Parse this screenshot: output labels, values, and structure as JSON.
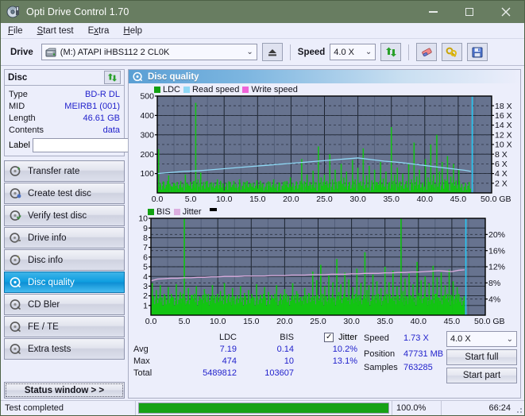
{
  "window": {
    "title": "Opti Drive Control 1.70",
    "icon": "disc-drive-icon",
    "minimize": "–",
    "maximize": "□",
    "close": "✕"
  },
  "menu": [
    {
      "label": "File",
      "accel": "F"
    },
    {
      "label": "Start test",
      "accel": "S"
    },
    {
      "label": "Extra",
      "accel": "x"
    },
    {
      "label": "Help",
      "accel": "H"
    }
  ],
  "toolbar": {
    "drive_label": "Drive",
    "drive_value": "(M:) ATAPI iHBS112  2 CL0K",
    "eject_icon": "eject-icon",
    "speed_label": "Speed",
    "speed_value": "4.0 X",
    "refresh_icon": "refresh-icon",
    "erase_icon": "eraser-icon",
    "settings_icon": "options-icon",
    "save_icon": "save-icon"
  },
  "disc": {
    "group_title": "Disc",
    "refresh_icon": "refresh-icon",
    "rows": [
      {
        "key": "Type",
        "value": "BD-R DL"
      },
      {
        "key": "MID",
        "value": "MEIRB1 (001)"
      },
      {
        "key": "Length",
        "value": "46.61 GB"
      },
      {
        "key": "Contents",
        "value": "data"
      }
    ],
    "label_key": "Label",
    "label_value": "",
    "label_placeholder": "",
    "label_button_icon": "disc-icon"
  },
  "sidebar": {
    "items": [
      {
        "label": "Transfer rate",
        "icon": "disc-speed-icon",
        "active": false
      },
      {
        "label": "Create test disc",
        "icon": "disc-burn-icon",
        "active": false
      },
      {
        "label": "Verify test disc",
        "icon": "disc-verify-icon",
        "active": false
      },
      {
        "label": "Drive info",
        "icon": "drive-info-icon",
        "active": false
      },
      {
        "label": "Disc info",
        "icon": "disc-info-icon",
        "active": false
      },
      {
        "label": "Disc quality",
        "icon": "disc-quality-icon",
        "active": true
      },
      {
        "label": "CD Bler",
        "icon": "disc-bler-icon",
        "active": false
      },
      {
        "label": "FE / TE",
        "icon": "disc-fete-icon",
        "active": false
      },
      {
        "label": "Extra tests",
        "icon": "disc-extra-icon",
        "active": false
      }
    ],
    "status_window": "Status window > >"
  },
  "panel": {
    "title": "Disc quality",
    "icon": "disc-quality-icon"
  },
  "stats": {
    "headers": {
      "blank": "",
      "ldc": "LDC",
      "bis": "BIS",
      "jitter": "Jitter"
    },
    "jitter_checked": true,
    "jitter_check_glyph": "✓",
    "rows": [
      {
        "label": "Avg",
        "ldc": "7.19",
        "bis": "0.14",
        "jitter": "10.2%"
      },
      {
        "label": "Max",
        "ldc": "474",
        "bis": "10",
        "jitter": "13.1%"
      },
      {
        "label": "Total",
        "ldc": "5489812",
        "bis": "103607",
        "jitter": ""
      }
    ]
  },
  "readout": {
    "speed_label": "Speed",
    "speed_value": "1.73 X",
    "position_label": "Position",
    "position_value": "47731 MB",
    "samples_label": "Samples",
    "samples_value": "763285",
    "speed_select": "4.0 X",
    "start_full": "Start full",
    "start_part": "Start part"
  },
  "statusbar": {
    "message": "Test completed",
    "percent_text": "100.0%",
    "percent_value": 100,
    "elapsed": "66:24"
  },
  "colors": {
    "title_bar": "#687d61",
    "ldc": "#12c412",
    "bis": "#12c412",
    "read_speed": "#8fd8f5",
    "write_speed": "#ef63d8",
    "jitter": "#dcaee0",
    "plot_bg": "#67738f",
    "accent": "#2222cc",
    "progress": "#16a216"
  },
  "chart_data": [
    {
      "type": "line",
      "title": "Disc quality - LDC / Read speed",
      "xlabel": "GB",
      "ylabel": "LDC",
      "xlim": [
        0,
        50
      ],
      "ylim": [
        0,
        500
      ],
      "xticks": [
        "0.0",
        "5.0",
        "10.0",
        "15.0",
        "20.0",
        "25.0",
        "30.0",
        "35.0",
        "40.0",
        "45.0",
        "50.0 GB"
      ],
      "yticks_left": [
        "100",
        "200",
        "300",
        "400",
        "500"
      ],
      "yticks_right": [
        "2 X",
        "4 X",
        "6 X",
        "8 X",
        "10 X",
        "12 X",
        "14 X",
        "16 X",
        "18 X"
      ],
      "ylim_right": [
        0,
        18
      ],
      "grid": true,
      "legend": [
        {
          "label": "LDC",
          "color": "#12a012"
        },
        {
          "label": "Read speed",
          "color": "#8fd8f5"
        },
        {
          "label": "Write speed",
          "color": "#ef63d8"
        }
      ],
      "series": [
        {
          "name": "LDC",
          "kind": "bars",
          "color": "#12c412",
          "x": [
            0.2,
            0.5,
            0.9,
            1.3,
            1.7,
            2.1,
            2.6,
            3.0,
            3.4,
            3.8,
            4.2,
            4.6,
            5.0,
            5.4,
            5.75,
            6.1,
            6.5,
            6.9,
            7.3,
            7.7,
            8.1,
            8.6,
            9.0,
            9.4,
            9.8,
            10.2,
            10.7,
            11.1,
            11.5,
            11.9,
            12.3,
            12.8,
            13.2,
            13.6,
            14.0,
            14.5,
            14.9,
            15.3,
            15.7,
            16.1,
            16.6,
            17.0,
            17.4,
            17.8,
            18.2,
            18.7,
            19.1,
            19.5,
            19.9,
            20.3,
            20.8,
            21.2,
            21.6,
            22.0,
            22.4,
            22.9,
            23.3,
            23.7,
            24.1,
            24.5,
            25.0,
            25.4,
            25.8,
            26.2,
            26.6,
            27.1,
            27.5,
            27.9,
            28.3,
            28.7,
            29.2,
            29.6,
            30.0,
            30.4,
            30.8,
            31.3,
            31.7,
            32.1,
            32.5,
            32.9,
            33.4,
            33.8,
            34.2,
            34.6,
            35.0,
            35.5,
            35.9,
            36.3,
            36.7,
            37.1,
            37.6,
            38.0,
            38.4,
            38.8,
            39.2,
            39.7,
            40.1,
            40.5,
            40.9,
            41.3,
            41.8,
            42.2,
            42.6,
            43.0,
            43.4,
            43.9,
            44.3,
            44.7,
            45.1,
            45.5,
            46.0,
            46.4,
            46.8
          ],
          "y": [
            225,
            40,
            60,
            30,
            90,
            35,
            50,
            25,
            40,
            30,
            95,
            45,
            35,
            60,
            465,
            70,
            105,
            40,
            60,
            30,
            55,
            25,
            70,
            35,
            50,
            20,
            60,
            30,
            45,
            25,
            70,
            35,
            55,
            30,
            50,
            25,
            65,
            30,
            50,
            25,
            60,
            30,
            70,
            35,
            55,
            25,
            60,
            30,
            80,
            40,
            60,
            30,
            175,
            60,
            95,
            45,
            115,
            55,
            240,
            80,
            95,
            50,
            200,
            70,
            120,
            60,
            150,
            80,
            110,
            55,
            170,
            70,
            130,
            60,
            230,
            90,
            140,
            65,
            120,
            55,
            160,
            75,
            110,
            50,
            340,
            95,
            130,
            60,
            100,
            45,
            150,
            70,
            260,
            85,
            120,
            55,
            175,
            80,
            250,
            95,
            300,
            110,
            160,
            70,
            190,
            85,
            150,
            65,
            120
          ]
        },
        {
          "name": "Read speed",
          "kind": "line",
          "color": "#8fd8f5",
          "axis": "right",
          "x": [
            0,
            2,
            4,
            6,
            8,
            10,
            12,
            14,
            16,
            18,
            20,
            22,
            24,
            26,
            28,
            30,
            32,
            34,
            36,
            38,
            40,
            42,
            44,
            46,
            46.9
          ],
          "y": [
            3.6,
            3.8,
            4.0,
            4.1,
            4.3,
            4.5,
            4.7,
            4.9,
            5.1,
            5.3,
            5.5,
            5.7,
            5.9,
            6.1,
            6.3,
            6.5,
            6.2,
            5.9,
            5.7,
            5.4,
            5.1,
            4.8,
            4.5,
            4.2,
            4.0
          ]
        },
        {
          "name": "Write speed",
          "kind": "line",
          "color": "#ef63d8",
          "axis": "right",
          "x": [],
          "y": []
        },
        {
          "name": "Marker",
          "kind": "vline",
          "color": "#28c8f4",
          "x": [
            47.1
          ],
          "y": []
        }
      ]
    },
    {
      "type": "line",
      "title": "Disc quality - BIS / Jitter",
      "xlabel": "GB",
      "ylabel": "BIS",
      "xlim": [
        0,
        50
      ],
      "ylim": [
        0,
        10
      ],
      "xticks": [
        "0.0",
        "5.0",
        "10.0",
        "15.0",
        "20.0",
        "25.0",
        "30.0",
        "35.0",
        "40.0",
        "45.0",
        "50.0 GB"
      ],
      "yticks_left": [
        "1",
        "2",
        "3",
        "4",
        "5",
        "6",
        "7",
        "8",
        "9",
        "10"
      ],
      "yticks_right": [
        "4%",
        "8%",
        "12%",
        "16%",
        "20%"
      ],
      "ylim_right": [
        0,
        22
      ],
      "grid": true,
      "legend": [
        {
          "label": "BIS",
          "color": "#12a012"
        },
        {
          "label": "Jitter",
          "color": "#dcaee0"
        }
      ],
      "series": [
        {
          "name": "BIS",
          "kind": "bars",
          "color": "#12c412",
          "x": [
            0.2,
            0.5,
            0.8,
            1.1,
            1.4,
            1.7,
            2.0,
            2.3,
            2.6,
            2.9,
            3.2,
            3.5,
            3.8,
            4.1,
            4.4,
            4.7,
            5.0,
            5.3,
            5.6,
            5.9,
            6.2,
            6.5,
            6.8,
            7.1,
            7.4,
            7.7,
            8.0,
            8.3,
            8.6,
            8.9,
            9.2,
            9.5,
            9.8,
            10.1,
            10.4,
            10.7,
            11.0,
            11.3,
            11.6,
            11.9,
            12.2,
            12.5,
            12.8,
            13.1,
            13.4,
            13.7,
            14.0,
            14.3,
            14.6,
            14.9,
            15.2,
            15.5,
            15.8,
            16.1,
            16.4,
            16.7,
            17.0,
            17.3,
            17.6,
            17.9,
            18.2,
            18.5,
            18.8,
            19.1,
            19.4,
            19.7,
            20.0,
            20.3,
            20.6,
            20.9,
            21.2,
            21.5,
            21.8,
            22.1,
            22.4,
            22.7,
            23.0,
            23.3,
            23.6,
            23.9,
            24.2,
            24.5,
            24.8,
            25.1,
            25.4,
            25.7,
            26.0,
            26.3,
            26.6,
            26.9,
            27.2,
            27.5,
            27.8,
            28.1,
            28.4,
            28.7,
            29.0,
            29.3,
            29.6,
            29.9,
            30.2,
            30.5,
            30.8,
            31.1,
            31.4,
            31.7,
            32.0,
            32.3,
            32.6,
            32.9,
            33.2,
            33.5,
            33.8,
            34.1,
            34.4,
            34.7,
            35.0,
            35.3,
            35.6,
            35.9,
            36.2,
            36.5,
            36.8,
            37.1,
            37.4,
            37.7,
            38.0,
            38.3,
            38.6,
            38.9,
            39.2,
            39.5,
            39.8,
            40.1,
            40.4,
            40.7,
            41.0,
            41.3,
            41.6,
            41.9,
            42.2,
            42.5,
            42.8,
            43.1,
            43.4,
            43.7,
            44.0,
            44.3,
            44.6,
            44.9,
            45.2,
            45.5,
            45.8,
            46.1,
            46.4,
            46.7
          ],
          "y": [
            3.3,
            1.1,
            2.6,
            1.0,
            3.1,
            1.0,
            2.2,
            1.0,
            2.9,
            1.0,
            1.9,
            1.0,
            3.2,
            1.0,
            2.4,
            1.0,
            10,
            1.2,
            2.8,
            1.0,
            2.1,
            1.0,
            3.0,
            1.0,
            1.8,
            1.0,
            2.7,
            1.0,
            2.2,
            1.0,
            3.1,
            1.0,
            1.9,
            1.0,
            2.5,
            1.0,
            3.3,
            1.0,
            2.0,
            1.0,
            2.8,
            1.0,
            1.7,
            1.0,
            3.0,
            1.0,
            2.3,
            1.0,
            2.6,
            1.0,
            1.9,
            1.0,
            3.2,
            1.0,
            2.1,
            1.0,
            2.9,
            1.0,
            2.4,
            1.0,
            1.8,
            1.0,
            3.1,
            1.0,
            2.2,
            1.0,
            2.7,
            1.0,
            2.0,
            1.0,
            3.3,
            1.0,
            2.5,
            1.0,
            1.9,
            1.0,
            2.8,
            1.0,
            2.3,
            1.0,
            4.5,
            2.0,
            3.6,
            1.5,
            5.2,
            2.2,
            3.0,
            1.4,
            4.1,
            1.8,
            3.4,
            1.6,
            5.8,
            2.4,
            3.2,
            1.5,
            4.4,
            1.9,
            3.7,
            1.7,
            2.9,
            1.4,
            4.8,
            2.1,
            3.3,
            1.6,
            6.5,
            2.6,
            3.1,
            1.5,
            4.2,
            1.8,
            3.5,
            1.6,
            2.8,
            1.4,
            5.0,
            2.2,
            3.4,
            1.7,
            4.6,
            1.9,
            3.0,
            1.5,
            10,
            2.5,
            3.8,
            1.8,
            4.3,
            2.0,
            3.2,
            1.6,
            5.5,
            2.3,
            3.6,
            1.7,
            4.0,
            1.9,
            3.3,
            1.6,
            5.1,
            2.2,
            3.9,
            1.8,
            4.4,
            2.0,
            3.1,
            1.5,
            4.7,
            2.1,
            3.5,
            1.7,
            2.9,
            1.4
          ]
        },
        {
          "name": "Jitter",
          "kind": "line",
          "color": "#dcaee0",
          "axis": "right",
          "x": [
            0,
            1,
            2,
            3,
            4,
            5,
            6,
            7,
            8,
            9,
            10,
            11,
            12,
            13,
            14,
            15,
            16,
            17,
            18,
            19,
            20,
            21,
            22,
            23,
            24,
            25,
            26,
            27,
            28,
            29,
            30,
            31,
            32,
            33,
            34,
            35,
            36,
            37,
            38,
            39,
            40,
            41,
            42,
            43,
            44,
            45,
            46,
            46.9
          ],
          "y": [
            7.8,
            8.2,
            8.3,
            8.4,
            8.4,
            8.5,
            8.5,
            8.6,
            8.6,
            8.7,
            8.7,
            8.8,
            8.8,
            8.8,
            8.9,
            8.9,
            8.9,
            8.9,
            9.0,
            9.0,
            9.0,
            9.1,
            9.1,
            9.1,
            9.2,
            9.2,
            9.2,
            9.3,
            9.3,
            9.3,
            9.4,
            9.4,
            9.5,
            9.5,
            9.5,
            9.6,
            9.6,
            9.7,
            9.7,
            9.8,
            9.8,
            9.9,
            10.0,
            10.1,
            10.0,
            9.9,
            10.2,
            10.3
          ]
        },
        {
          "name": "Marker",
          "kind": "vline",
          "color": "#28c8f4",
          "x": [
            47.1
          ],
          "y": []
        }
      ]
    }
  ]
}
